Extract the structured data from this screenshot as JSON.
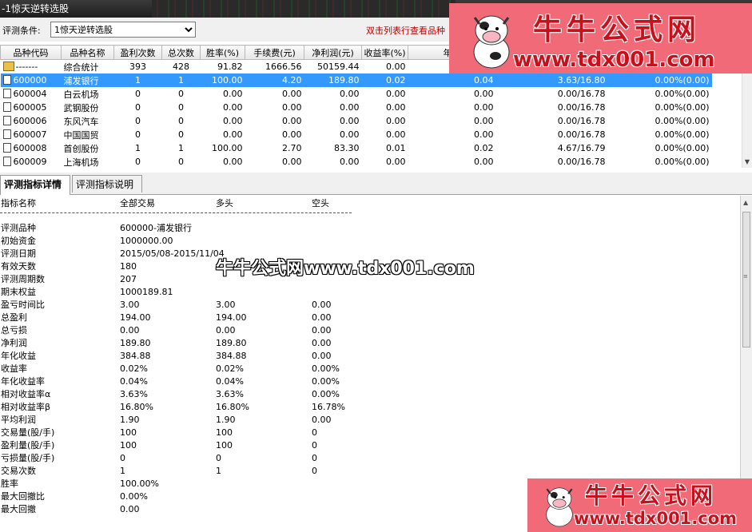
{
  "window": {
    "title": "-1惊天逆转选股"
  },
  "filter": {
    "label": "评测条件:",
    "selected": "1惊天逆转选股",
    "hint": "双击列表行查看品种"
  },
  "grid": {
    "columns": [
      "品种代码",
      "品种名称",
      "盈利次数",
      "总次数",
      "胜率(%)",
      "手续费(元)",
      "净利润(元)",
      "收益率(%)",
      "年化"
    ],
    "rows": [
      {
        "code": "-------",
        "name": "综合统计",
        "win": "393",
        "total": "428",
        "rate": "91.82",
        "fee": "1666.56",
        "profit": "50159.44",
        "ret": "0.00",
        "annual": "",
        "rel": "",
        "extra": ""
      },
      {
        "code": "600000",
        "name": "浦发银行",
        "win": "1",
        "total": "1",
        "rate": "100.00",
        "fee": "4.20",
        "profit": "189.80",
        "ret": "0.02",
        "annual": "0.04",
        "rel": "3.63/16.80",
        "extra": "0.00%(0.00)"
      },
      {
        "code": "600004",
        "name": "白云机场",
        "win": "0",
        "total": "0",
        "rate": "0.00",
        "fee": "0.00",
        "profit": "0.00",
        "ret": "0.00",
        "annual": "0.00",
        "rel": "0.00/16.78",
        "extra": "0.00%(0.00)"
      },
      {
        "code": "600005",
        "name": "武钢股份",
        "win": "0",
        "total": "0",
        "rate": "0.00",
        "fee": "0.00",
        "profit": "0.00",
        "ret": "0.00",
        "annual": "0.00",
        "rel": "0.00/16.78",
        "extra": "0.00%(0.00)"
      },
      {
        "code": "600006",
        "name": "东风汽车",
        "win": "0",
        "total": "0",
        "rate": "0.00",
        "fee": "0.00",
        "profit": "0.00",
        "ret": "0.00",
        "annual": "0.00",
        "rel": "0.00/16.78",
        "extra": "0.00%(0.00)"
      },
      {
        "code": "600007",
        "name": "中国国贸",
        "win": "0",
        "total": "0",
        "rate": "0.00",
        "fee": "0.00",
        "profit": "0.00",
        "ret": "0.00",
        "annual": "0.00",
        "rel": "0.00/16.78",
        "extra": "0.00%(0.00)"
      },
      {
        "code": "600008",
        "name": "首创股份",
        "win": "1",
        "total": "1",
        "rate": "100.00",
        "fee": "2.70",
        "profit": "83.30",
        "ret": "0.01",
        "annual": "0.02",
        "rel": "4.67/16.79",
        "extra": "0.00%(0.00)"
      },
      {
        "code": "600009",
        "name": "上海机场",
        "win": "0",
        "total": "0",
        "rate": "0.00",
        "fee": "0.00",
        "profit": "0.00",
        "ret": "0.00",
        "annual": "0.00",
        "rel": "0.00/16.78",
        "extra": "0.00%(0.00)"
      }
    ],
    "selected_index": 1
  },
  "tabs": [
    {
      "label": "评测指标详情",
      "active": true
    },
    {
      "label": "评测指标说明",
      "active": false
    }
  ],
  "detail": {
    "headers": [
      "指标名称",
      "全部交易",
      "多头",
      "空头"
    ],
    "rows": [
      [
        "评测品种",
        "600000-浦发银行",
        "",
        ""
      ],
      [
        "初始资金",
        "1000000.00",
        "",
        ""
      ],
      [
        "评测日期",
        "2015/05/08-2015/11/04",
        "",
        ""
      ],
      [
        "有效天数",
        "180",
        "",
        ""
      ],
      [
        "评测周期数",
        "207",
        "",
        ""
      ],
      [
        "期末权益",
        "1000189.81",
        "",
        ""
      ],
      [
        "盈亏时间比",
        "3.00",
        "3.00",
        "0.00"
      ],
      [
        "总盈利",
        "194.00",
        "194.00",
        "0.00"
      ],
      [
        "总亏损",
        "0.00",
        "0.00",
        "0.00"
      ],
      [
        "净利润",
        "189.80",
        "189.80",
        "0.00"
      ],
      [
        "年化收益",
        "384.88",
        "384.88",
        "0.00"
      ],
      [
        "收益率",
        "0.02%",
        "0.02%",
        "0.00%"
      ],
      [
        "年化收益率",
        "0.04%",
        "0.04%",
        "0.00%"
      ],
      [
        "相对收益率α",
        "3.63%",
        "3.63%",
        "0.00%"
      ],
      [
        "相对收益率β",
        "16.80%",
        "16.80%",
        "16.78%"
      ],
      [
        "平均利润",
        "1.90",
        "1.90",
        "0.00"
      ],
      [
        "交易量(股/手)",
        "100",
        "100",
        "0"
      ],
      [
        "盈利量(股/手)",
        "100",
        "100",
        "0"
      ],
      [
        "亏损量(股/手)",
        "0",
        "0",
        "0"
      ],
      [
        "交易次数",
        "1",
        "1",
        "0"
      ],
      [
        "胜率",
        "100.00%",
        "",
        ""
      ],
      [
        "最大回撤比",
        "0.00%",
        "",
        ""
      ],
      [
        "最大回撤",
        "0.00",
        "",
        ""
      ]
    ]
  },
  "watermarks": {
    "mid": "牛牛公式网www.tdx001.com",
    "logo_cn": "牛牛公式网",
    "logo_url": "www.tdx001.com"
  },
  "colors": {
    "selection": "#3399ff",
    "hint": "#c00000",
    "logo_bg": "#f06a78",
    "logo_text": "#c8101c"
  }
}
